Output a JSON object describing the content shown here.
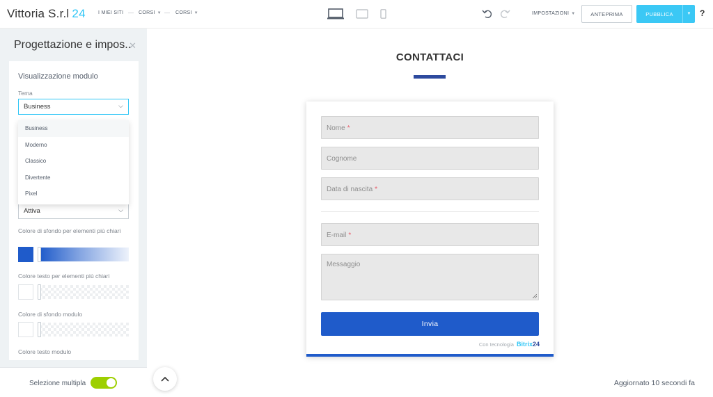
{
  "topbar": {
    "brand_name": "Vittoria S.r.l",
    "brand_number": "24",
    "nav": [
      "I MIEI SITI",
      "CORSI",
      "CORSI"
    ],
    "settings_label": "IMPOSTAZIONI",
    "preview_label": "ANTEPRIMA",
    "publish_label": "PUBBLICA",
    "help_label": "?"
  },
  "panel": {
    "title": "Progettazione e impos...",
    "section_title": "Visualizzazione modulo",
    "theme_label": "Tema",
    "theme_value": "Business",
    "theme_options": [
      "Business",
      "Moderno",
      "Classico",
      "Divertente",
      "Pixel"
    ],
    "second_select_value": "Attiva",
    "light_bg_label": "Colore di sfondo per elementi più chiari",
    "light_text_label": "Colore testo per elementi più chiari",
    "form_bg_label": "Colore di sfondo modulo",
    "form_text_label": "Colore testo modulo",
    "multi_select_label": "Selezione multipla"
  },
  "colors": {
    "accent": "#1f5bca",
    "brand_cyan": "#2fc6f6",
    "toggle_on": "#9dcf00"
  },
  "canvas": {
    "page_title": "CONTATTACI",
    "fields": {
      "name": "Nome",
      "surname": "Cognome",
      "birthdate": "Data di nascita",
      "email": "E-mail",
      "message": "Messaggio"
    },
    "required_mark": "*",
    "submit_label": "Invia",
    "powered_by": "Con tecnologia",
    "powered_brand": "Bitrix",
    "powered_brand_num": "24",
    "updated_text": "Aggiornato 10 secondi fa"
  }
}
